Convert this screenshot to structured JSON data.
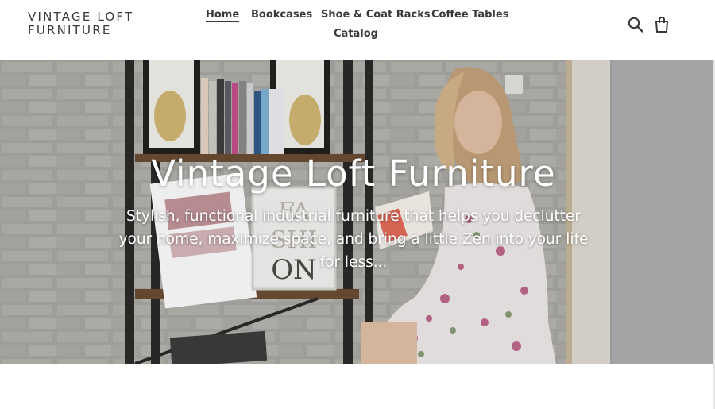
{
  "site": {
    "logo_line1": "VINTAGE LOFT",
    "logo_line2": "FURNITURE"
  },
  "nav": {
    "items": [
      {
        "label": "Home",
        "active": true
      },
      {
        "label": "Bookcases"
      },
      {
        "label": "Shoe & Coat Racks"
      },
      {
        "label": "Coffee Tables"
      },
      {
        "label": "Catalog"
      }
    ]
  },
  "icons": {
    "search": "search-icon",
    "cart": "cart-icon"
  },
  "hero": {
    "title": "Vintage Loft Furniture",
    "subtitle_line1": "Stylish, functional industrial furniture that helps you declutter",
    "subtitle_line2": "your home, maximize space, and bring a little Zen into your life",
    "subtitle_line3": "for less...",
    "poster_text_1": "FA",
    "poster_text_2": "SHI",
    "poster_text_3": "ON"
  },
  "colors": {
    "text_dark": "#3a3a3a",
    "hero_text": "#ffffff"
  }
}
